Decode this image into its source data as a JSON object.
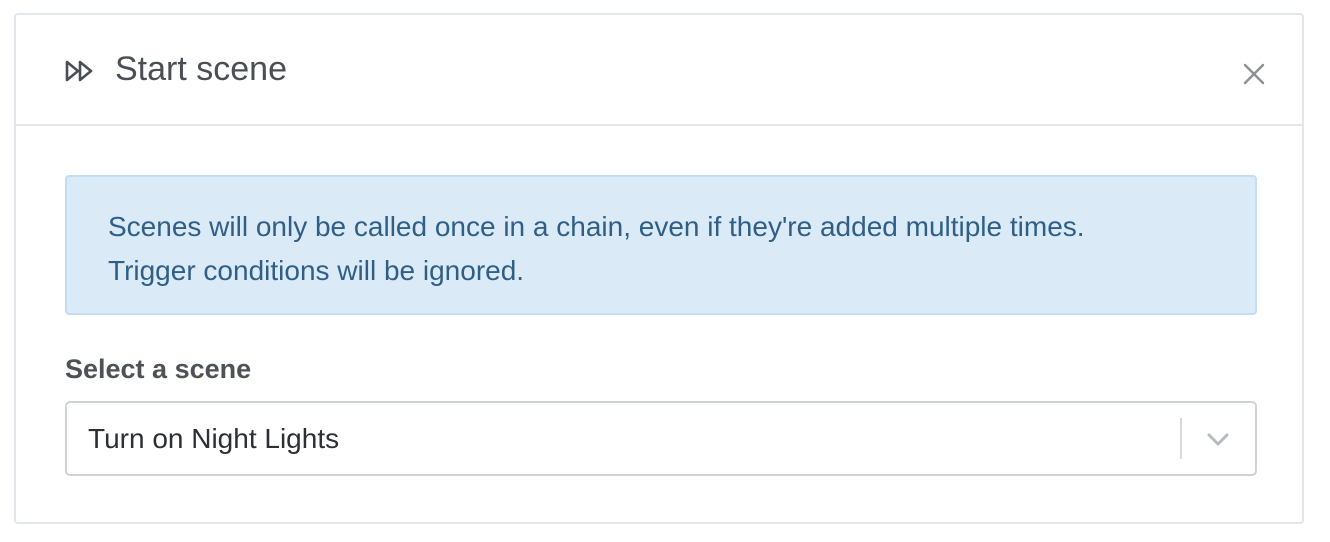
{
  "dialog": {
    "title": "Start scene",
    "icon": "fast-forward-icon",
    "close_icon": "close-icon"
  },
  "notice": {
    "line1": "Scenes will only be called once in a chain, even if they're added multiple times.",
    "line2": "Trigger conditions will be ignored."
  },
  "scene_select": {
    "label": "Select a scene",
    "value": "Turn on Night Lights",
    "icon": "chevron-down-icon"
  },
  "colors": {
    "notice_background": "#dbeaf7",
    "notice_text": "#2f5f86",
    "border": "#e3e6ea"
  }
}
